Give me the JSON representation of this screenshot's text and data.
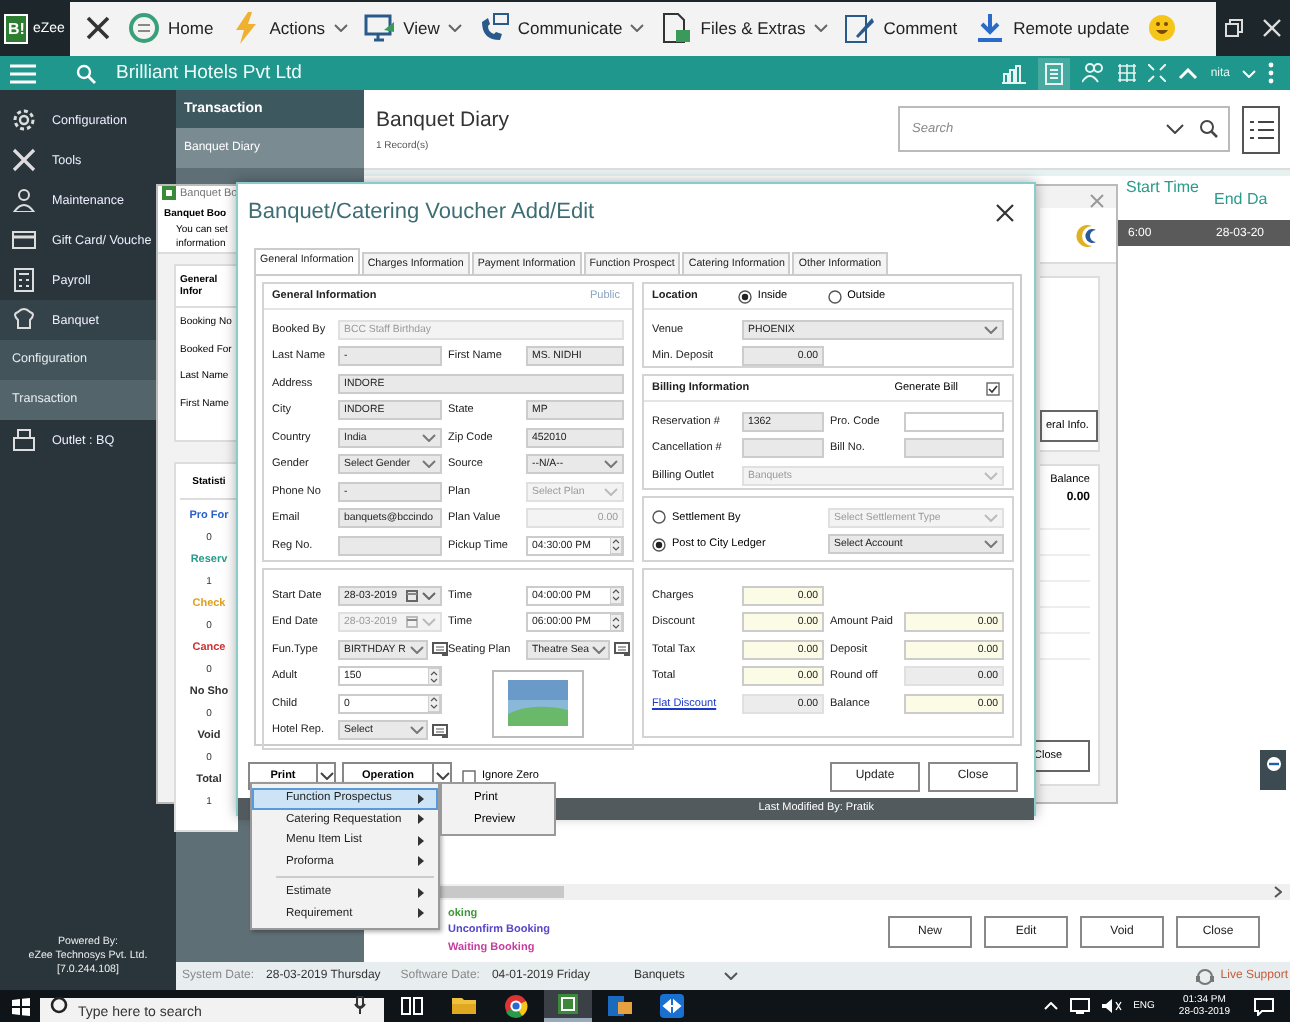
{
  "topbar": {
    "logo_badge": "B!",
    "logo": "eZee",
    "items": [
      {
        "label": "Home",
        "dropdown": false
      },
      {
        "label": "Actions",
        "dropdown": true
      },
      {
        "label": "View",
        "dropdown": true
      },
      {
        "label": "Communicate",
        "dropdown": true
      },
      {
        "label": "Files & Extras",
        "dropdown": true
      },
      {
        "label": "Comment",
        "dropdown": false
      },
      {
        "label": "Remote update",
        "dropdown": false
      }
    ]
  },
  "header": {
    "title": "Brilliant Hotels Pvt Ltd",
    "user": "nita"
  },
  "sidebar": {
    "items": [
      {
        "label": "Configuration",
        "selected": false
      },
      {
        "label": "Tools",
        "selected": false
      },
      {
        "label": "Maintenance",
        "selected": false
      },
      {
        "label": "Gift Card/ Vouche",
        "selected": false
      },
      {
        "label": "Payroll",
        "selected": false
      },
      {
        "label": "Banquet",
        "selected": true
      }
    ],
    "sections": [
      {
        "label": "Configuration",
        "selected": false
      },
      {
        "label": "Transaction",
        "selected": true
      }
    ],
    "outlet": "Outlet : BQ",
    "powered_by": [
      "Powered By:",
      "eZee Technosys Pvt. Ltd.",
      "[7.0.244.108]"
    ]
  },
  "subnav": {
    "title": "Transaction",
    "items": [
      {
        "label": "Banquet Diary",
        "selected": true
      }
    ]
  },
  "main": {
    "title": "Banquet Diary",
    "count": "1 Record(s)",
    "search": {
      "placeholder": "Search"
    },
    "columns": [
      "Start Time",
      "End Da"
    ],
    "rows": [
      {
        "cells": [
          "6:00",
          "28-03-20"
        ],
        "selected": true
      }
    ],
    "legend": [
      {
        "label": "oking",
        "color": "#3c9a3c"
      },
      {
        "label": "Unconfirm Booking",
        "color": "#5646c8"
      },
      {
        "label": "Waiting Booking",
        "color": "#c83ca0"
      }
    ],
    "buttons": [
      "New",
      "Edit",
      "Void",
      "Close"
    ]
  },
  "status_bar": {
    "system_label": "System Date:",
    "system_date": "28-03-2019 Thursday",
    "software_label": "Software Date:",
    "software_date": "04-01-2019 Friday",
    "outlet": "Banquets",
    "support": "Live Support"
  },
  "background_window": {
    "title": "Banquet Bo",
    "heading": "Banquet Boo",
    "note": [
      "You can set",
      "information"
    ],
    "general": {
      "title": "General Infor",
      "labels": [
        "Booking No",
        "Booked For",
        "Last Name",
        "First Name"
      ]
    },
    "statistics": {
      "title": "Statisti",
      "items": [
        {
          "label": "Pro For",
          "value": "0",
          "color": "#2a5fd0"
        },
        {
          "label": "Reserv",
          "value": "1",
          "color": "#2a9a8a"
        },
        {
          "label": "Check",
          "value": "0",
          "color": "#e0a020"
        },
        {
          "label": "Cance",
          "value": "0",
          "color": "#d03030"
        },
        {
          "label": "No Sho",
          "value": "0",
          "color": "#333333"
        },
        {
          "label": "Void",
          "value": "0",
          "color": "#333333"
        },
        {
          "label": "Total",
          "value": "1",
          "color": "#333333"
        }
      ]
    },
    "info_button": "eral Info.",
    "balance_label": "Balance",
    "balance": "0.00",
    "close": "Close"
  },
  "dialog": {
    "title": "Banquet/Catering Voucher Add/Edit",
    "tabs": [
      {
        "label": "General Information",
        "selected": true
      },
      {
        "label": "Charges Information",
        "selected": false
      },
      {
        "label": "Payment Information",
        "selected": false
      },
      {
        "label": "Function Prospect",
        "selected": false
      },
      {
        "label": "Catering Information",
        "selected": false
      },
      {
        "label": "Other Information",
        "selected": false
      }
    ],
    "general": {
      "title": "General Information",
      "badge": "Public",
      "rows": [
        [
          {
            "label": "Booked By",
            "value": "BCC Staff Birthday",
            "kind": "text",
            "disabled": true,
            "wide": true
          }
        ],
        [
          {
            "label": "Last Name",
            "value": "-",
            "kind": "text",
            "disabled": false
          },
          {
            "label": "First Name",
            "value": "MS. NIDHI",
            "kind": "text",
            "disabled": false
          }
        ],
        [
          {
            "label": "Address",
            "value": "INDORE",
            "kind": "text",
            "disabled": false,
            "wide": true
          }
        ],
        [
          {
            "label": "City",
            "value": "INDORE",
            "kind": "text",
            "disabled": false
          },
          {
            "label": "State",
            "value": "MP",
            "kind": "text",
            "disabled": false
          }
        ],
        [
          {
            "label": "Country",
            "value": "India",
            "kind": "select",
            "disabled": false
          },
          {
            "label": "Zip Code",
            "value": "452010",
            "kind": "text",
            "disabled": false
          }
        ],
        [
          {
            "label": "Gender",
            "value": "Select Gender",
            "kind": "select",
            "disabled": false
          },
          {
            "label": "Source",
            "value": "--N/A--",
            "kind": "select",
            "disabled": false
          }
        ],
        [
          {
            "label": "Phone No",
            "value": "-",
            "kind": "text",
            "disabled": false
          },
          {
            "label": "Plan",
            "value": "Select Plan",
            "kind": "select",
            "disabled": true
          }
        ],
        [
          {
            "label": "Email",
            "value": "banquets@bccindo",
            "kind": "text",
            "disabled": false
          },
          {
            "label": "Plan Value",
            "value": "0.00",
            "kind": "number",
            "disabled": true
          }
        ],
        [
          {
            "label": "Reg No.",
            "kind": "text",
            "disabled": false
          },
          {
            "label": "Pickup Time",
            "value": "04:30:00 PM",
            "kind": "spin",
            "disabled": false
          }
        ]
      ]
    },
    "schedule": {
      "rows": [
        [
          {
            "label": "Start Date",
            "value": "28-03-2019",
            "kind": "date",
            "disabled": false
          },
          {
            "label": "Time",
            "value": "04:00:00 PM",
            "kind": "spin",
            "disabled": false
          }
        ],
        [
          {
            "label": "End Date",
            "value": "28-03-2019",
            "kind": "date",
            "disabled": true
          },
          {
            "label": "Time",
            "value": "06:00:00 PM",
            "kind": "spin",
            "disabled": false
          }
        ],
        [
          {
            "label": "Fun.Type",
            "value": "BIRTHDAY R",
            "kind": "select",
            "disabled": false,
            "button": true
          },
          {
            "label": "Seating Plan",
            "value": "Theatre Sea",
            "kind": "select",
            "disabled": false,
            "button": true
          }
        ]
      ],
      "counts": [
        {
          "label": "Adult",
          "value": "150",
          "kind": "spin",
          "disabled": false
        },
        {
          "label": "Child",
          "value": "0",
          "kind": "spin",
          "disabled": false
        },
        {
          "label": "Hotel Rep.",
          "value": "Select",
          "kind": "select",
          "disabled": false,
          "button": true
        }
      ]
    },
    "location": {
      "title": "Location",
      "options": [
        {
          "label": "Inside",
          "selected": true
        },
        {
          "label": "Outside",
          "selected": false
        }
      ],
      "rows": [
        [
          {
            "label": "Venue",
            "value": "PHOENIX",
            "kind": "select",
            "disabled": false,
            "wide": true
          }
        ],
        [
          {
            "label": "Min. Deposit",
            "value": "0.00",
            "kind": "number",
            "disabled": false
          }
        ]
      ]
    },
    "billing": {
      "title": "Billing Information",
      "generate_label": "Generate Bill",
      "generate_bill": true,
      "rows": [
        [
          {
            "label": "Reservation #",
            "value": "1362",
            "kind": "text",
            "disabled": false
          },
          {
            "label": "Pro. Code",
            "kind": "input",
            "disabled": false
          }
        ],
        [
          {
            "label": "Cancellation #",
            "kind": "text",
            "disabled": false
          },
          {
            "label": "Bill No.",
            "kind": "text",
            "disabled": false
          }
        ],
        [
          {
            "label": "Billing Outlet",
            "value": "Banquets",
            "kind": "select",
            "disabled": true,
            "wide": true
          }
        ]
      ]
    },
    "settlement": [
      {
        "label": "Settlement By",
        "selected": false,
        "value": "Select Settlement Type",
        "disabled": true
      },
      {
        "label": "Post to City Ledger",
        "selected": true,
        "value": "Select Account",
        "disabled": false
      }
    ],
    "charges": {
      "rows": [
        [
          {
            "label": "Charges",
            "value": "0.00",
            "kind": "amount",
            "disabled": false
          }
        ],
        [
          {
            "label": "Discount",
            "value": "0.00",
            "kind": "amount",
            "disabled": false
          },
          {
            "label": "Amount Paid",
            "value": "0.00",
            "kind": "amount",
            "disabled": false
          }
        ],
        [
          {
            "label": "Total Tax",
            "value": "0.00",
            "kind": "amount",
            "disabled": false
          },
          {
            "label": "Deposit",
            "value": "0.00",
            "kind": "amount",
            "disabled": false
          }
        ],
        [
          {
            "label": "Total",
            "value": "0.00",
            "kind": "amount",
            "disabled": false
          },
          {
            "label": "Round off",
            "value": "0.00",
            "kind": "amount",
            "disabled": true
          }
        ],
        [
          {
            "label": "Flat Discount",
            "link": true,
            "value": "0.00",
            "kind": "amount",
            "disabled": true
          },
          {
            "label": "Balance",
            "value": "0.00",
            "kind": "amount",
            "disabled": false
          }
        ]
      ]
    },
    "print_button": "Print",
    "operation_button": "Operation",
    "ignore_zero": {
      "label": "Ignore Zero",
      "checked": false
    },
    "buttons": [
      "Update",
      "Close"
    ],
    "footer": "Last Modified By:  Pratik"
  },
  "context_menu": {
    "items": [
      {
        "label": "Function Prospectus",
        "selected": true,
        "separator_before": false
      },
      {
        "label": "Catering Requestation",
        "selected": false,
        "separator_before": false
      },
      {
        "label": "Menu Item List",
        "selected": false,
        "separator_before": false
      },
      {
        "label": "Proforma",
        "selected": false,
        "separator_before": false
      },
      {
        "label": "Estimate",
        "selected": false,
        "separator_before": true
      },
      {
        "label": "Requirement",
        "selected": false,
        "separator_before": false
      }
    ],
    "submenu": [
      "Print",
      "Preview"
    ]
  },
  "taskbar": {
    "search_placeholder": "Type here to search",
    "language": "ENG",
    "time": "01:34 PM",
    "date": "28-03-2019"
  }
}
